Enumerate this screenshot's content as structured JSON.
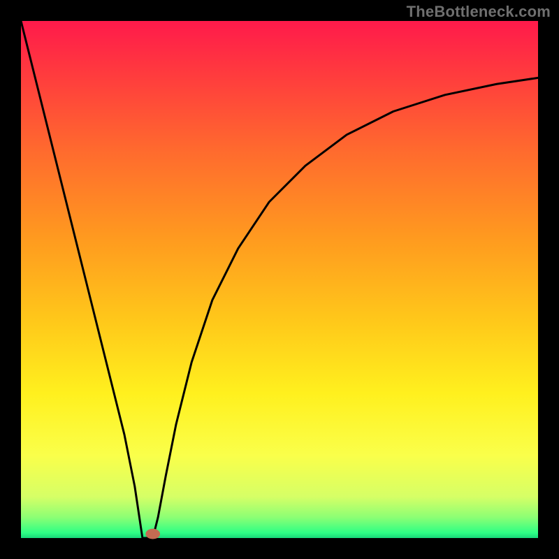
{
  "watermark": "TheBottleneck.com",
  "chart_data": {
    "type": "line",
    "title": "",
    "xlabel": "",
    "ylabel": "",
    "xlim": [
      0,
      100
    ],
    "ylim": [
      0,
      100
    ],
    "background_gradient": {
      "stops": [
        {
          "offset": 0.0,
          "color": "#ff1a4b"
        },
        {
          "offset": 0.1,
          "color": "#ff3a3e"
        },
        {
          "offset": 0.25,
          "color": "#ff6a2e"
        },
        {
          "offset": 0.42,
          "color": "#ff9a1f"
        },
        {
          "offset": 0.58,
          "color": "#ffc81a"
        },
        {
          "offset": 0.72,
          "color": "#fff01e"
        },
        {
          "offset": 0.84,
          "color": "#faff4a"
        },
        {
          "offset": 0.92,
          "color": "#d6ff66"
        },
        {
          "offset": 0.96,
          "color": "#8cff74"
        },
        {
          "offset": 0.99,
          "color": "#2eff85"
        },
        {
          "offset": 1.0,
          "color": "#18d87a"
        }
      ]
    },
    "plot_border_color": "#000000",
    "plot_border_width": 30,
    "series": [
      {
        "name": "left-branch",
        "x": [
          0,
          5,
          10,
          15,
          20,
          22,
          23.5,
          25.5
        ],
        "y": [
          100,
          80,
          60,
          40,
          20,
          10,
          0,
          0
        ],
        "stroke": "#000000",
        "width": 3
      },
      {
        "name": "right-branch",
        "x": [
          25.5,
          26.5,
          28,
          30,
          33,
          37,
          42,
          48,
          55,
          63,
          72,
          82,
          92,
          100
        ],
        "y": [
          0,
          4,
          12,
          22,
          34,
          46,
          56,
          65,
          72,
          78,
          82.5,
          85.7,
          87.8,
          89
        ],
        "stroke": "#000000",
        "width": 3
      }
    ],
    "marker": {
      "x": 25.5,
      "y": 0.8,
      "rx_pct": 1.4,
      "ry_pct": 1.0,
      "fill": "#c46b52"
    },
    "optimum_x": 25.5
  }
}
